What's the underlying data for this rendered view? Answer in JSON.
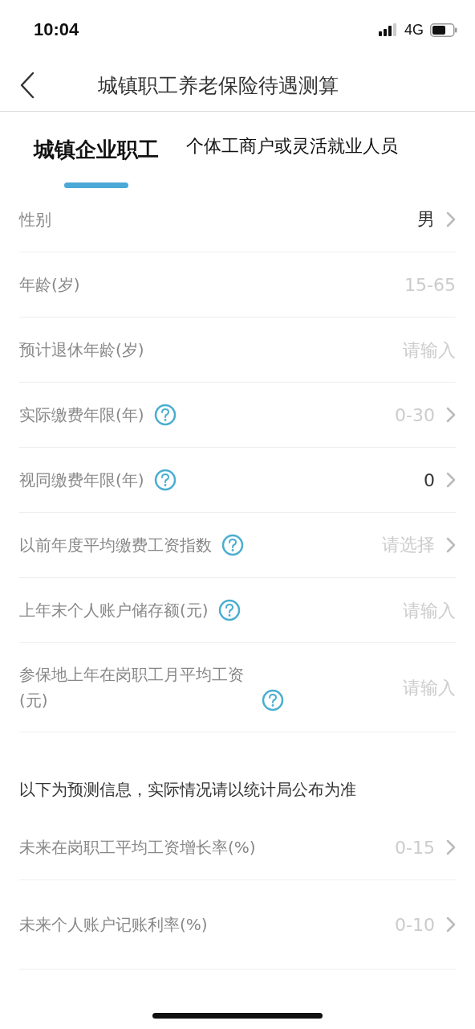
{
  "status_bar": {
    "time": "10:04",
    "network": "4G"
  },
  "nav": {
    "title": "城镇职工养老保险待遇测算"
  },
  "tabs": [
    {
      "label": "城镇企业职工",
      "selected": true
    },
    {
      "label": "个体工商户或灵活就业人员",
      "selected": false
    }
  ],
  "fields": [
    {
      "kind": "select",
      "label": "性别",
      "help": false,
      "value": "男"
    },
    {
      "kind": "input",
      "label": "年龄(岁)",
      "help": false,
      "placeholder": "15-65"
    },
    {
      "kind": "input",
      "label": "预计退休年龄(岁)",
      "help": false,
      "placeholder": "请输入"
    },
    {
      "kind": "select",
      "label": "实际缴费年限(年)",
      "help": true,
      "placeholder": "0-30"
    },
    {
      "kind": "select",
      "label": "视同缴费年限(年)",
      "help": true,
      "value": "0"
    },
    {
      "kind": "select",
      "label": "以前年度平均缴费工资指数",
      "help": true,
      "placeholder": "请选择"
    },
    {
      "kind": "input",
      "label": "上年末个人账户储存额(元)",
      "help": true,
      "placeholder": "请输入"
    },
    {
      "kind": "input",
      "label": "参保地上年在岗职工月平均工资(元)",
      "help": true,
      "placeholder": "请输入"
    }
  ],
  "forecast": {
    "note": "以下为预测信息，实际情况请以统计局公布为准",
    "fields": [
      {
        "kind": "select",
        "label": "未来在岗职工平均工资增长率(%)",
        "help": false,
        "placeholder": "0-15"
      },
      {
        "kind": "select",
        "label": "未来个人账户记账利率(%)",
        "help": false,
        "placeholder": "0-10"
      }
    ]
  }
}
